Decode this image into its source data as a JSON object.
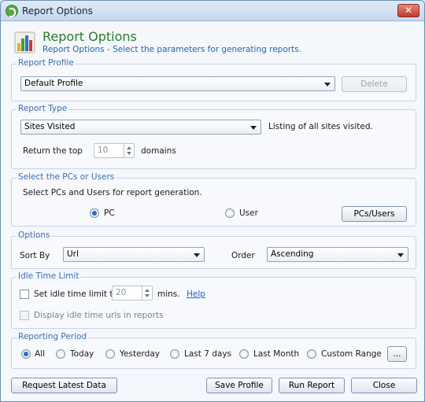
{
  "window": {
    "title": "Report Options",
    "close": "✕"
  },
  "header": {
    "title": "Report Options",
    "subtitle": "Report Options - Select the parameters for generating reports."
  },
  "report_profile": {
    "legend": "Report Profile",
    "selected": "Default Profile",
    "delete_label": "Delete"
  },
  "report_type": {
    "legend": "Report Type",
    "selected": "Sites Visited",
    "description": "Listing of all sites visited.",
    "return_top_label": "Return the top",
    "top_value": "10",
    "unit_label": "domains"
  },
  "pcs_users": {
    "legend": "Select the PCs or Users",
    "description": "Select PCs and Users for report generation.",
    "pc_label": "PC",
    "user_label": "User",
    "button_label": "PCs/Users"
  },
  "options": {
    "legend": "Options",
    "sort_by_label": "Sort By",
    "sort_by_value": "Url",
    "order_label": "Order",
    "order_value": "Ascending"
  },
  "idle": {
    "legend": "Idle Time Limit",
    "set_limit_label": "Set idle time limit to",
    "limit_value": "20",
    "unit_label": "mins.",
    "help_label": "Help",
    "display_label": "Display idle time urls in reports"
  },
  "period": {
    "legend": "Reporting Period",
    "options": [
      "All",
      "Today",
      "Yesterday",
      "Last 7 days",
      "Last Month",
      "Custom Range"
    ],
    "selected": "All",
    "more_label": "..."
  },
  "footer": {
    "request_label": "Request Latest Data",
    "save_label": "Save Profile",
    "run_label": "Run Report",
    "close_label": "Close"
  },
  "colors": {
    "accent": "#2b6bc7",
    "title_green": "#2d7a2d",
    "legend_blue": "#3d6fb0"
  },
  "icons": {
    "app": "app-logo-icon",
    "report": "bar-chart-icon"
  }
}
